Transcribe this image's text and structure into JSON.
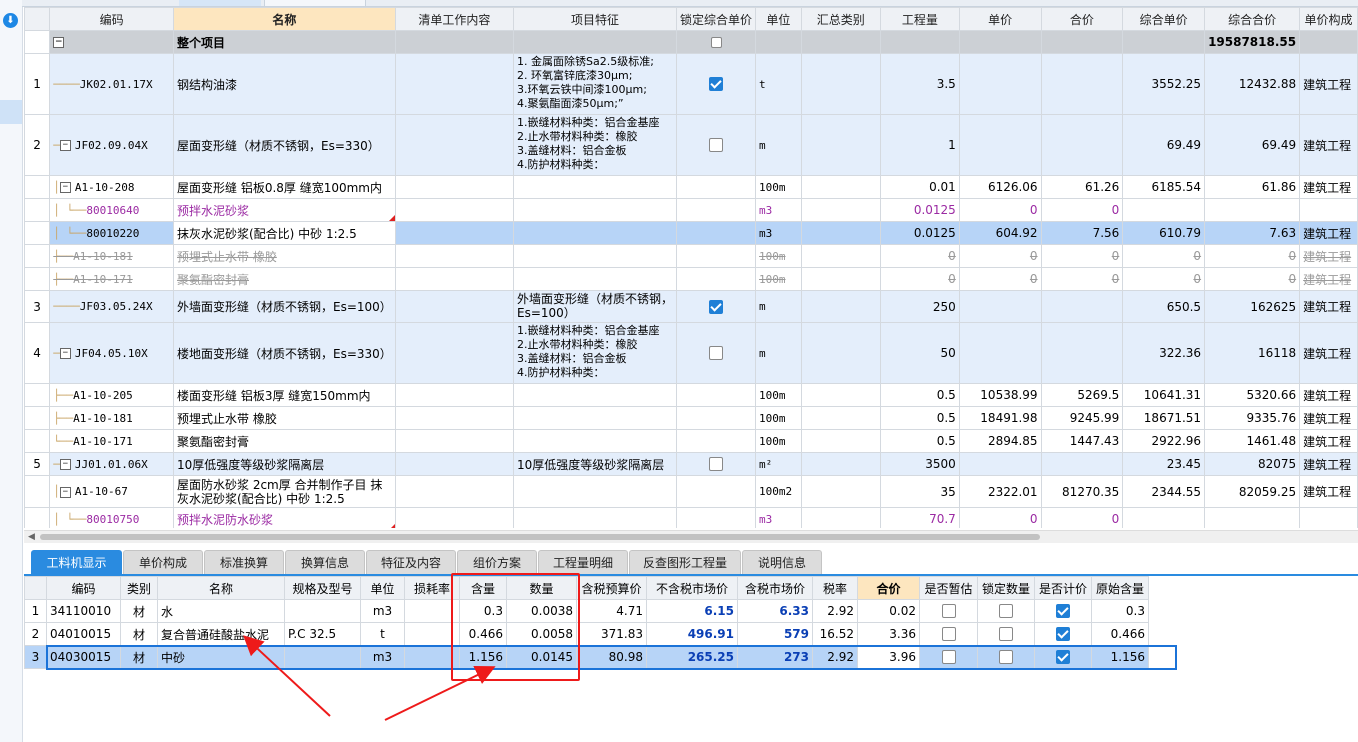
{
  "upper_headers": [
    "编码",
    "名称",
    "清单工作内容",
    "项目特征",
    "锁定综合单价",
    "单位",
    "汇总类别",
    "工程量",
    "单价",
    "合价",
    "综合单价",
    "综合合价",
    "单价构成"
  ],
  "whole_project": {
    "name": "整个项目",
    "total": "19587818.55"
  },
  "rows": [
    {
      "rn": "1",
      "code": "JK02.01.17X",
      "name": "钢结构油漆",
      "feature": "1. 金属面除锈Sa2.5级标准;\n2. 环氧富锌底漆30μm;\n3.环氧云铁中间漆100μm;\n4.聚氨酯面漆50μm;”",
      "unit": "t",
      "qty": "3.5",
      "price": "",
      "amount": "",
      "comp_price": "3552.25",
      "comp_amount": "12432.88",
      "compose": "建筑工程"
    },
    {
      "rn": "2",
      "code": "JF02.09.04X",
      "name": "屋面变形缝（材质不锈钢，Es=330）",
      "feature": "1.嵌缝材料种类：铝合金基座\n2.止水带材料种类：橡胶\n3.盖缝材料：铝合金板\n4.防护材料种类：",
      "unit": "m",
      "qty": "1",
      "price": "",
      "amount": "",
      "comp_price": "69.49",
      "comp_amount": "69.49",
      "compose": "建筑工程"
    },
    {
      "rn": "",
      "code": "A1-10-208",
      "name": "屋面变形缝 铝板0.8厚 缝宽100mm内",
      "unit": "100m",
      "qty": "0.01",
      "price": "6126.06",
      "amount": "61.26",
      "comp_price": "6185.54",
      "comp_amount": "61.86",
      "compose": "建筑工程"
    },
    {
      "rn": "",
      "code": "80010640",
      "name": "预拌水泥砂浆",
      "unit": "m3",
      "qty": "0.0125",
      "price": "0",
      "amount": "0",
      "comp_price": "",
      "comp_amount": "",
      "compose": ""
    },
    {
      "rn": "",
      "code": "80010220",
      "name": "抹灰水泥砂浆(配合比) 中砂 1:2.5",
      "unit": "m3",
      "qty": "0.0125",
      "price": "604.92",
      "amount": "7.56",
      "comp_price": "610.79",
      "comp_amount": "7.63",
      "compose": "建筑工程"
    },
    {
      "rn": "",
      "code": "A1-10-181",
      "name": "预埋式止水带 橡胶",
      "unit": "100m",
      "qty": "0",
      "price": "0",
      "amount": "0",
      "comp_price": "0",
      "comp_amount": "0",
      "compose": "建筑工程"
    },
    {
      "rn": "",
      "code": "A1-10-171",
      "name": "聚氨酯密封膏",
      "unit": "100m",
      "qty": "0",
      "price": "0",
      "amount": "0",
      "comp_price": "0",
      "comp_amount": "0",
      "compose": "建筑工程"
    },
    {
      "rn": "3",
      "code": "JF03.05.24X",
      "name": "外墙面变形缝（材质不锈钢，Es=100）",
      "feature": "外墙面变形缝（材质不锈钢，\nEs=100）",
      "unit": "m",
      "qty": "250",
      "price": "",
      "amount": "",
      "comp_price": "650.5",
      "comp_amount": "162625",
      "compose": "建筑工程"
    },
    {
      "rn": "4",
      "code": "JF04.05.10X",
      "name": "楼地面变形缝（材质不锈钢，Es=330）",
      "feature": "1.嵌缝材料种类：铝合金基座\n2.止水带材料种类：橡胶\n3.盖缝材料：铝合金板\n4.防护材料种类：",
      "unit": "m",
      "qty": "50",
      "price": "",
      "amount": "",
      "comp_price": "322.36",
      "comp_amount": "16118",
      "compose": "建筑工程"
    },
    {
      "rn": "",
      "code": "A1-10-205",
      "name": "楼面变形缝 铝板3厚 缝宽150mm内",
      "unit": "100m",
      "qty": "0.5",
      "price": "10538.99",
      "amount": "5269.5",
      "comp_price": "10641.31",
      "comp_amount": "5320.66",
      "compose": "建筑工程"
    },
    {
      "rn": "",
      "code": "A1-10-181",
      "name": "预埋式止水带 橡胶",
      "unit": "100m",
      "qty": "0.5",
      "price": "18491.98",
      "amount": "9245.99",
      "comp_price": "18671.51",
      "comp_amount": "9335.76",
      "compose": "建筑工程"
    },
    {
      "rn": "",
      "code": "A1-10-171",
      "name": "聚氨酯密封膏",
      "unit": "100m",
      "qty": "0.5",
      "price": "2894.85",
      "amount": "1447.43",
      "comp_price": "2922.96",
      "comp_amount": "1461.48",
      "compose": "建筑工程"
    },
    {
      "rn": "5",
      "code": "JJ01.01.06X",
      "name": "10厚低强度等级砂浆隔离层",
      "feature": "10厚低强度等级砂浆隔离层",
      "unit": "m²",
      "qty": "3500",
      "price": "",
      "amount": "",
      "comp_price": "23.45",
      "comp_amount": "82075",
      "compose": "建筑工程"
    },
    {
      "rn": "",
      "code": "A1-10-67",
      "name": "屋面防水砂浆 2cm厚  合并制作子目 抹",
      "name2": "灰水泥砂浆(配合比) 中砂 1:2.5",
      "unit": "100m2",
      "qty": "35",
      "price": "2322.01",
      "amount": "81270.35",
      "comp_price": "2344.55",
      "comp_amount": "82059.25",
      "compose": "建筑工程"
    },
    {
      "rn": "",
      "code": "80010750",
      "name": "预拌水泥防水砂浆",
      "unit": "m3",
      "qty": "70.7",
      "price": "0",
      "amount": "0",
      "comp_price": "",
      "comp_amount": "",
      "compose": ""
    }
  ],
  "tabs": [
    "工料机显示",
    "单价构成",
    "标准换算",
    "换算信息",
    "特征及内容",
    "组价方案",
    "工程量明细",
    "反查图形工程量",
    "说明信息"
  ],
  "lower_headers": [
    "编码",
    "类别",
    "名称",
    "规格及型号",
    "单位",
    "损耗率",
    "含量",
    "数量",
    "含税预算价",
    "不含税市场价",
    "含税市场价",
    "税率",
    "合价",
    "是否暂估",
    "锁定数量",
    "是否计价",
    "原始含量"
  ],
  "lower_rows": [
    {
      "rn": "1",
      "code": "34110010",
      "cat": "材",
      "name": "水",
      "spec": "",
      "unit": "m3",
      "loss": "",
      "content": "0.3",
      "qty": "0.0038",
      "tax_budget": "4.71",
      "notax_market": "6.15",
      "tax_market": "6.33",
      "rate": "2.92",
      "amount": "0.02",
      "orig": "0.3"
    },
    {
      "rn": "2",
      "code": "04010015",
      "cat": "材",
      "name": "复合普通硅酸盐水泥",
      "spec": "P.C 32.5",
      "unit": "t",
      "loss": "",
      "content": "0.466",
      "qty": "0.0058",
      "tax_budget": "371.83",
      "notax_market": "496.91",
      "tax_market": "579",
      "rate": "16.52",
      "amount": "3.36",
      "orig": "0.466"
    },
    {
      "rn": "3",
      "code": "04030015",
      "cat": "材",
      "name": "中砂",
      "spec": "",
      "unit": "m3",
      "loss": "",
      "content": "1.156",
      "qty": "0.0145",
      "tax_budget": "80.98",
      "notax_market": "265.25",
      "tax_market": "273",
      "rate": "2.92",
      "amount": "3.96",
      "orig": "1.156"
    }
  ],
  "colors": {
    "accent": "#2a8be0",
    "annotation": "#ee1a1a",
    "selected_row": "#b7d4f7",
    "header_highlight": "#fde6bf"
  }
}
